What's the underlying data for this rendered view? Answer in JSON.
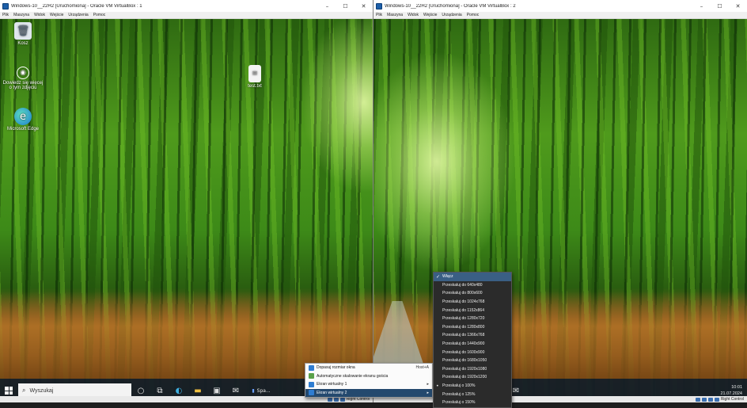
{
  "window1": {
    "title": "Windows-10__22H2 [Uruchomiona] - Oracle VM VirtualBox : 1",
    "menu": [
      "Plik",
      "Maszyna",
      "Widok",
      "Wejście",
      "Urządzenia",
      "Pomoc"
    ],
    "desktop_icons": [
      {
        "label": "Kosz",
        "icon": "recycle-bin-icon"
      },
      {
        "label": "Dowiedz się więcej o tym zdjęciu",
        "icon": "camera-icon"
      },
      {
        "label": "Microsoft Edge",
        "icon": "edge-icon"
      },
      {
        "label": "test.txt",
        "icon": "text-file-icon"
      }
    ],
    "taskbar": {
      "search_label": "Wyszukaj",
      "app_label": "Spa..."
    },
    "status_host_key": "Right Control"
  },
  "window2": {
    "title": "Windows-10__22H2 [Uruchomiona] - Oracle VM VirtualBox : 2",
    "menu": [
      "Plik",
      "Maszyna",
      "Widok",
      "Wejście",
      "Urządzenia",
      "Pomoc"
    ],
    "clock_time": "10:01",
    "clock_date": "21.07.2024",
    "status_host_key": "Right Control"
  },
  "context_menu": {
    "items": [
      {
        "label": "Dopasuj rozmiar okna",
        "shortcut": "Host+A"
      },
      {
        "label": "Automatyczne skalowanie ekranu gościa",
        "shortcut": ""
      },
      {
        "label": "Ekran wirtualny 1",
        "shortcut": "▸"
      },
      {
        "label": "Ekran wirtualny 2",
        "shortcut": "▸"
      }
    ]
  },
  "submenu": {
    "items": [
      {
        "label": "Włącz",
        "checked": "✓"
      },
      {
        "label": "Przeskaluj do 640x480",
        "checked": ""
      },
      {
        "label": "Przeskaluj do 800x600",
        "checked": ""
      },
      {
        "label": "Przeskaluj do 1024x768",
        "checked": ""
      },
      {
        "label": "Przeskaluj do 1152x864",
        "checked": ""
      },
      {
        "label": "Przeskaluj do 1280x720",
        "checked": ""
      },
      {
        "label": "Przeskaluj do 1280x800",
        "checked": ""
      },
      {
        "label": "Przeskaluj do 1366x768",
        "checked": ""
      },
      {
        "label": "Przeskaluj do 1440x900",
        "checked": ""
      },
      {
        "label": "Przeskaluj do 1600x900",
        "checked": ""
      },
      {
        "label": "Przeskaluj do 1680x1050",
        "checked": ""
      },
      {
        "label": "Przeskaluj do 1920x1080",
        "checked": ""
      },
      {
        "label": "Przeskaluj do 1920x1200",
        "checked": ""
      },
      {
        "label": "Przeskaluj o 100%",
        "checked": "•"
      },
      {
        "label": "Przeskaluj o 125%",
        "checked": ""
      },
      {
        "label": "Przeskaluj o 150%",
        "checked": ""
      }
    ]
  }
}
